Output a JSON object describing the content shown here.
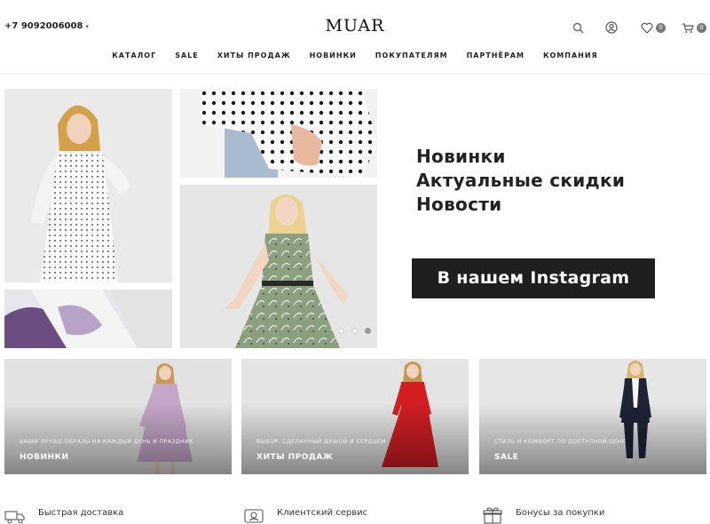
{
  "header": {
    "phone": "+7 9092006008",
    "logo": "MUAR",
    "wishlist_count": "0",
    "cart_count": "0"
  },
  "nav": {
    "items": [
      {
        "label": "КАТАЛОГ"
      },
      {
        "label": "SALE"
      },
      {
        "label": "ХИТЫ ПРОДАЖ"
      },
      {
        "label": "НОВИНКИ"
      },
      {
        "label": "ПОКУПАТЕЛЯМ"
      },
      {
        "label": "ПАРТНЁРАМ"
      },
      {
        "label": "КОМПАНИЯ"
      }
    ]
  },
  "hero": {
    "lines": [
      "Новинки",
      "Актуальные скидки",
      "Новости"
    ],
    "instagram_button": "В нашем Instagram",
    "slider_count": 3,
    "slider_active": 3
  },
  "cards": [
    {
      "subtitle": "ВАШИ ЛУЧШЕ ОБРАЗЫ НА КАЖДЫЙ ДЕНЬ И ПРАЗДНИК",
      "title": "НОВИНКИ"
    },
    {
      "subtitle": "ВЫБОР, СДЕЛАННЫЙ ДУШОЙ И СЕРДЦЕМ",
      "title": "ХИТЫ ПРОДАЖ"
    },
    {
      "subtitle": "СТИЛЬ И КОМФОРТ ПО ДОСТУПНОЙ ЦЕНЕ",
      "title": "SALE"
    }
  ],
  "features": [
    {
      "label": "Быстрая доставка",
      "icon": "truck-icon"
    },
    {
      "label": "Клиентский сервис",
      "icon": "headset-icon"
    },
    {
      "label": "Бонусы за покупки",
      "icon": "gift-icon"
    }
  ],
  "icons": [
    "search-icon",
    "user-icon",
    "heart-icon",
    "cart-icon",
    "chevron-down-icon"
  ],
  "colors": {
    "accent_dark": "#1f1f1f",
    "badge": "#777777",
    "dress_red": "#d21f23",
    "dress_green": "#8aa07e",
    "dress_lilac": "#c5a6c9",
    "suit_navy": "#1e2436"
  }
}
